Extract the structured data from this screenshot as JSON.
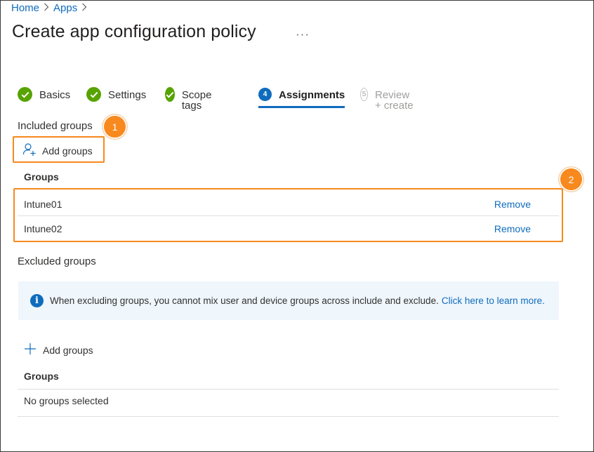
{
  "breadcrumb": {
    "home": "Home",
    "apps": "Apps",
    "separator": ">"
  },
  "page": {
    "title": "Create app configuration policy",
    "more": "···"
  },
  "steps": [
    {
      "label": "Basics",
      "state": "complete"
    },
    {
      "label": "Settings",
      "state": "complete"
    },
    {
      "label": "Scope tags",
      "state": "complete"
    },
    {
      "label": "Assignments",
      "number": "4",
      "state": "active"
    },
    {
      "label": "Review + create",
      "number": "5",
      "state": "disabled"
    }
  ],
  "included": {
    "title": "Included groups",
    "callout": "1",
    "add_label": "Add groups",
    "table_header": "Groups",
    "callout_rows": "2",
    "rows": [
      {
        "name": "Intune01",
        "action": "Remove"
      },
      {
        "name": "Intune02",
        "action": "Remove"
      }
    ]
  },
  "excluded": {
    "title": "Excluded groups",
    "info_text": "When excluding groups, you cannot mix user and device groups across include and exclude.",
    "info_link": "Click here to learn more.",
    "add_label": "Add groups",
    "table_header": "Groups",
    "empty": "No groups selected"
  },
  "colors": {
    "accent": "#0f6cbd",
    "success": "#57a300",
    "highlight": "#f7891e",
    "info_bg": "#eff6fc"
  }
}
